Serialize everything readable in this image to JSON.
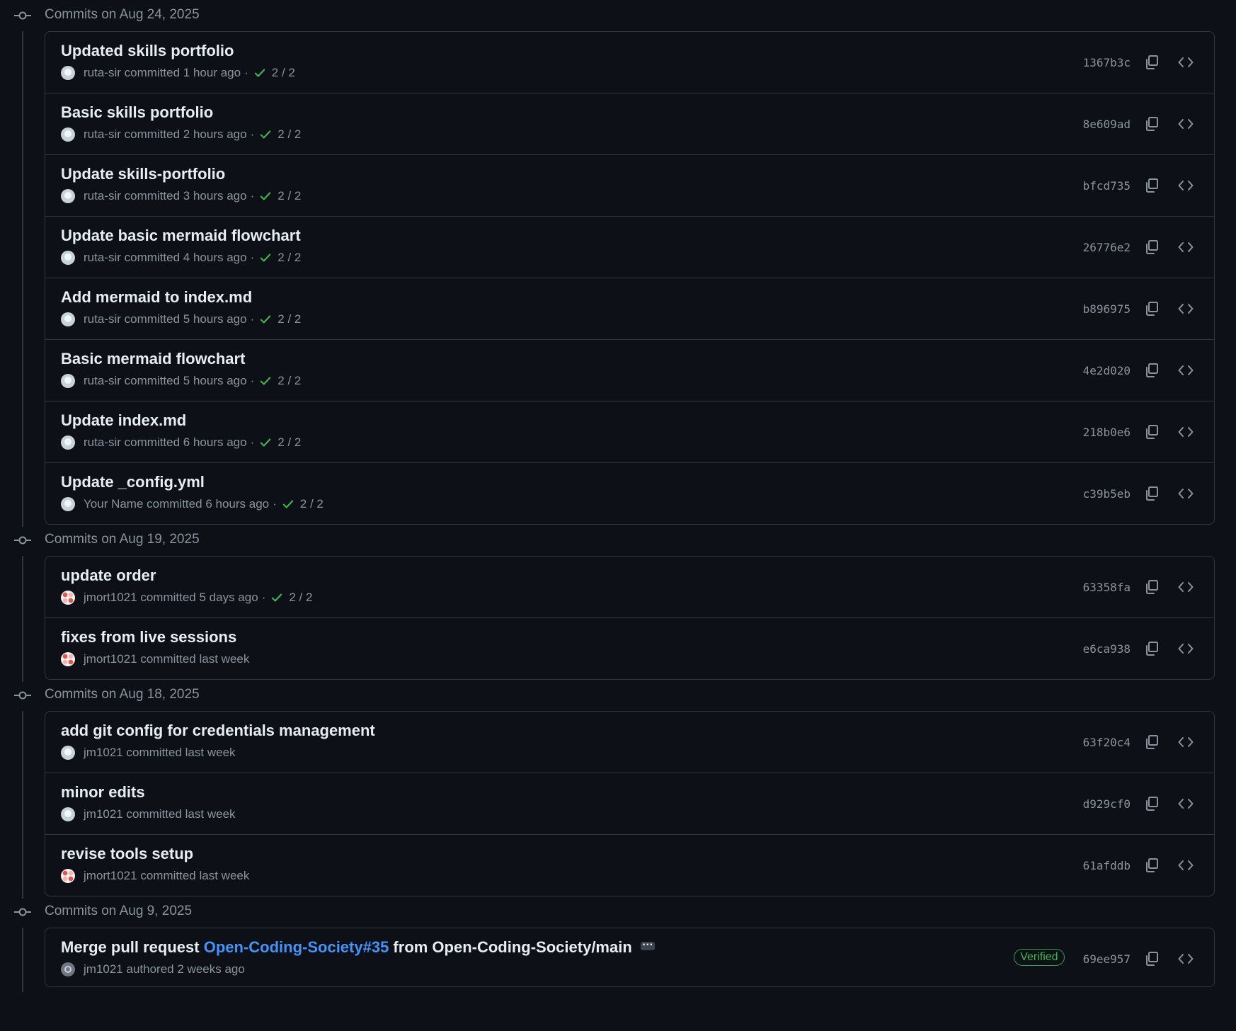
{
  "groups": [
    {
      "title": "Commits on Aug 24, 2025",
      "commits": [
        {
          "message": "Updated skills portfolio",
          "author": "ruta-sir",
          "action": "committed",
          "time": "1 hour ago",
          "checks": "2 / 2",
          "sha": "1367b3c",
          "avatar": "default"
        },
        {
          "message": "Basic skills portfolio",
          "author": "ruta-sir",
          "action": "committed",
          "time": "2 hours ago",
          "checks": "2 / 2",
          "sha": "8e609ad",
          "avatar": "default"
        },
        {
          "message": "Update skills-portfolio",
          "author": "ruta-sir",
          "action": "committed",
          "time": "3 hours ago",
          "checks": "2 / 2",
          "sha": "bfcd735",
          "avatar": "default"
        },
        {
          "message": "Update basic mermaid flowchart",
          "author": "ruta-sir",
          "action": "committed",
          "time": "4 hours ago",
          "checks": "2 / 2",
          "sha": "26776e2",
          "avatar": "default"
        },
        {
          "message": "Add mermaid to index.md",
          "author": "ruta-sir",
          "action": "committed",
          "time": "5 hours ago",
          "checks": "2 / 2",
          "sha": "b896975",
          "avatar": "default"
        },
        {
          "message": "Basic mermaid flowchart",
          "author": "ruta-sir",
          "action": "committed",
          "time": "5 hours ago",
          "checks": "2 / 2",
          "sha": "4e2d020",
          "avatar": "default"
        },
        {
          "message": "Update index.md",
          "author": "ruta-sir",
          "action": "committed",
          "time": "6 hours ago",
          "checks": "2 / 2",
          "sha": "218b0e6",
          "avatar": "default"
        },
        {
          "message": "Update _config.yml",
          "author": "Your Name",
          "action": "committed",
          "time": "6 hours ago",
          "checks": "2 / 2",
          "sha": "c39b5eb",
          "avatar": "default"
        }
      ]
    },
    {
      "title": "Commits on Aug 19, 2025",
      "commits": [
        {
          "message": "update order",
          "author": "jmort1021",
          "action": "committed",
          "time": "5 days ago",
          "checks": "2 / 2",
          "sha": "63358fa",
          "avatar": "pattern"
        },
        {
          "message": "fixes from live sessions",
          "author": "jmort1021",
          "action": "committed",
          "time": "last week",
          "checks": "",
          "sha": "e6ca938",
          "avatar": "pattern"
        }
      ]
    },
    {
      "title": "Commits on Aug 18, 2025",
      "commits": [
        {
          "message": "add git config for credentials management",
          "author": "jm1021",
          "action": "committed",
          "time": "last week",
          "checks": "",
          "sha": "63f20c4",
          "avatar": "default"
        },
        {
          "message": "minor edits",
          "author": "jm1021",
          "action": "committed",
          "time": "last week",
          "checks": "",
          "sha": "d929cf0",
          "avatar": "default"
        },
        {
          "message": "revise tools setup",
          "author": "jmort1021",
          "action": "committed",
          "time": "last week",
          "checks": "",
          "sha": "61afddb",
          "avatar": "pattern"
        }
      ]
    },
    {
      "title": "Commits on Aug 9, 2025",
      "commits": [
        {
          "message_prefix": "Merge pull request ",
          "message_link": "Open-Coding-Society#35",
          "message_suffix": " from Open-Coding-Society/main",
          "has_ellipsis": true,
          "author": "jm1021",
          "action": "authored",
          "time": "2 weeks ago",
          "checks": "",
          "verified": "Verified",
          "sha": "69ee957",
          "avatar": "org"
        }
      ]
    }
  ],
  "icons": {
    "node": "git-commit-icon",
    "check": "check-icon",
    "copy": "copy-icon",
    "browse": "code-icon"
  },
  "colors": {
    "background": "#0d1117",
    "border": "#30363d",
    "muted": "#8b949e",
    "success": "#3fb950",
    "link": "#4493f8"
  }
}
